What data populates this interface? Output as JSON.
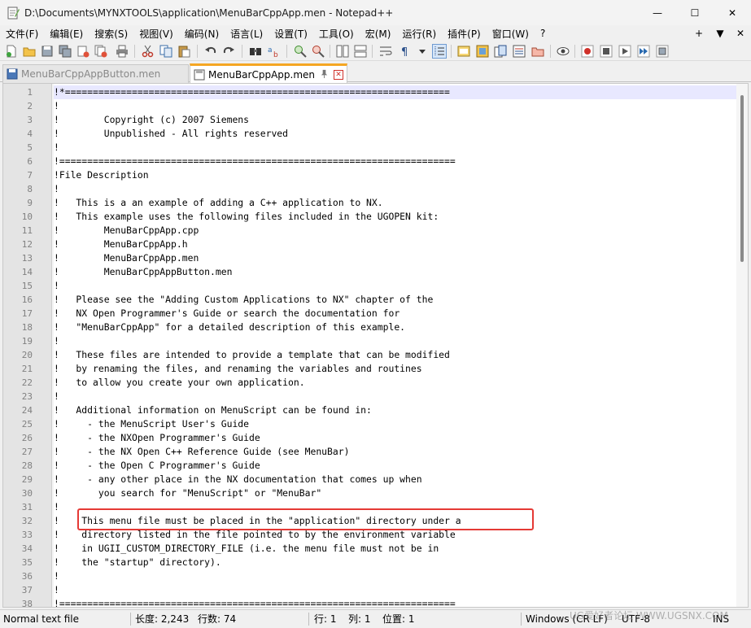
{
  "window": {
    "title": "D:\\Documents\\MYNXTOOLS\\application\\MenuBarCppApp.men - Notepad++",
    "minimize_glyph": "—",
    "maximize_glyph": "☐",
    "close_glyph": "✕"
  },
  "menubar": {
    "items": [
      "文件(F)",
      "编辑(E)",
      "搜索(S)",
      "视图(V)",
      "编码(N)",
      "语言(L)",
      "设置(T)",
      "工具(O)",
      "宏(M)",
      "运行(R)",
      "插件(P)",
      "窗口(W)",
      "?"
    ],
    "right_plus": "+",
    "right_down": "▼",
    "right_close": "✕"
  },
  "tabs": [
    {
      "label": "MenuBarCppAppButton.men",
      "active": false
    },
    {
      "label": "MenuBarCppApp.men",
      "active": true,
      "pin_glyph": "📌",
      "close_glyph": "✕"
    }
  ],
  "editor": {
    "current_line": 1,
    "lines": [
      {
        "n": "1",
        "text": "!*====================================================================="
      },
      {
        "n": "2",
        "text": "!"
      },
      {
        "n": "3",
        "text": "!        Copyright (c) 2007 Siemens"
      },
      {
        "n": "4",
        "text": "!        Unpublished - All rights reserved"
      },
      {
        "n": "5",
        "text": "!"
      },
      {
        "n": "6",
        "text": "!======================================================================="
      },
      {
        "n": "7",
        "text": "!File Description"
      },
      {
        "n": "8",
        "text": "!"
      },
      {
        "n": "9",
        "text": "!   This is a an example of adding a C++ application to NX."
      },
      {
        "n": "10",
        "text": "!   This example uses the following files included in the UGOPEN kit:"
      },
      {
        "n": "11",
        "text": "!        MenuBarCppApp.cpp"
      },
      {
        "n": "12",
        "text": "!        MenuBarCppApp.h"
      },
      {
        "n": "13",
        "text": "!        MenuBarCppApp.men"
      },
      {
        "n": "14",
        "text": "!        MenuBarCppAppButton.men"
      },
      {
        "n": "15",
        "text": "!"
      },
      {
        "n": "16",
        "text": "!   Please see the \"Adding Custom Applications to NX\" chapter of the"
      },
      {
        "n": "17",
        "text": "!   NX Open Programmer's Guide or search the documentation for"
      },
      {
        "n": "18",
        "text": "!   \"MenuBarCppApp\" for a detailed description of this example."
      },
      {
        "n": "19",
        "text": "!"
      },
      {
        "n": "20",
        "text": "!   These files are intended to provide a template that can be modified"
      },
      {
        "n": "21",
        "text": "!   by renaming the files, and renaming the variables and routines"
      },
      {
        "n": "22",
        "text": "!   to allow you create your own application."
      },
      {
        "n": "23",
        "text": "!"
      },
      {
        "n": "24",
        "text": "!   Additional information on MenuScript can be found in:"
      },
      {
        "n": "25",
        "text": "!     - the MenuScript User's Guide"
      },
      {
        "n": "26",
        "text": "!     - the NXOpen Programmer's Guide"
      },
      {
        "n": "27",
        "text": "!     - the NX Open C++ Reference Guide (see MenuBar)"
      },
      {
        "n": "28",
        "text": "!     - the Open C Programmer's Guide"
      },
      {
        "n": "29",
        "text": "!     - any other place in the NX documentation that comes up when"
      },
      {
        "n": "30",
        "text": "!       you search for \"MenuScript\" or \"MenuBar\""
      },
      {
        "n": "31",
        "text": "!"
      },
      {
        "n": "32",
        "text": "!    This menu file must be placed in the \"application\" directory under a"
      },
      {
        "n": "33",
        "text": "!    directory listed in the file pointed to by the environment variable"
      },
      {
        "n": "34",
        "text": "!    in UGII_CUSTOM_DIRECTORY_FILE (i.e. the menu file must not be in"
      },
      {
        "n": "35",
        "text": "!    the \"startup\" directory)."
      },
      {
        "n": "36",
        "text": "!"
      },
      {
        "n": "37",
        "text": "!"
      },
      {
        "n": "38",
        "text": "!======================================================================="
      }
    ]
  },
  "statusbar": {
    "file_type": "Normal text file",
    "length": "长度: 2,243",
    "lines": "行数: 74",
    "line": "行: 1",
    "col": "列: 1",
    "pos": "位置: 1",
    "eol": "Windows (CR LF)",
    "encoding": "UTF-8",
    "mode": "INS"
  },
  "watermark": "UG爱好者论坛 WWW.UGSNX.COM",
  "colors": {
    "active_tab_accent": "#f5a623",
    "highlight_box": "#e53935",
    "current_line_bg": "#e8e8ff"
  }
}
